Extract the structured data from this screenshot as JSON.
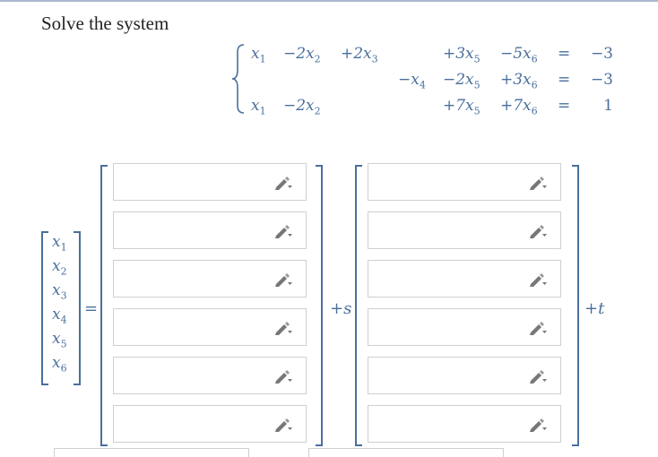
{
  "title": "Solve the system",
  "system": [
    {
      "cells": [
        "x1",
        "−2x2",
        "+2x3",
        "",
        "+3x5",
        "−5x6"
      ],
      "eq": "=",
      "rhs": "−3"
    },
    {
      "cells": [
        "",
        "",
        "",
        "−x4",
        "−2x5",
        "+3x6"
      ],
      "eq": "=",
      "rhs": "−3"
    },
    {
      "cells": [
        "x1",
        "−2x2",
        "",
        "",
        "+7x5",
        "+7x6"
      ],
      "eq": "=",
      "rhs": "1"
    }
  ],
  "variables": [
    "x1",
    "x2",
    "x3",
    "x4",
    "x5",
    "x6"
  ],
  "equals_sign": "=",
  "param_s": "+s",
  "param_t": "+t",
  "vector1_values": [
    "",
    "",
    "",
    "",
    "",
    ""
  ],
  "vector2_values": [
    "",
    "",
    "",
    "",
    "",
    ""
  ],
  "icons": {
    "field_icon": "pencil-icon"
  },
  "colors": {
    "math": "#4a6f9c",
    "field_border": "#cfcfcf"
  }
}
